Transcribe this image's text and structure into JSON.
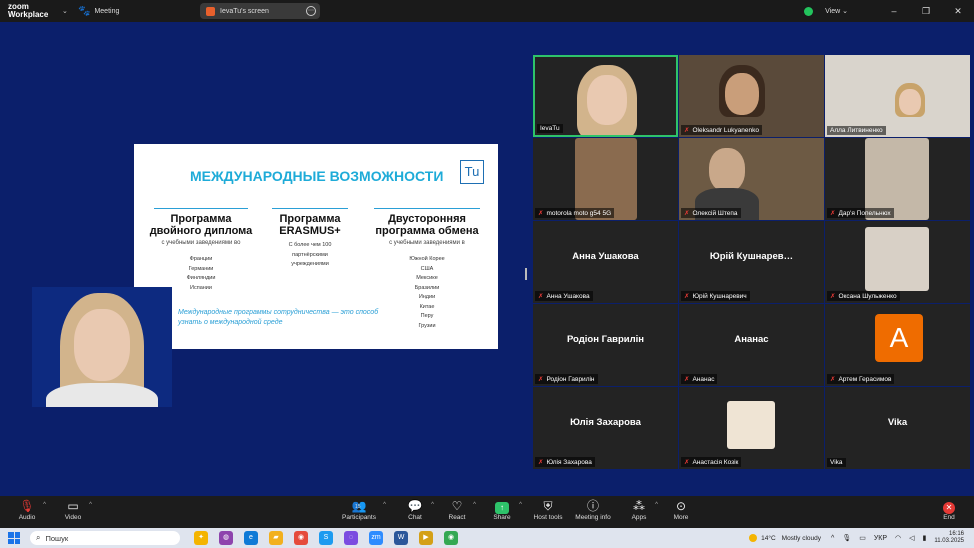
{
  "titlebar": {
    "logo_line1": "zoom",
    "logo_line2": "Workplace",
    "meeting_label": "Meeting",
    "screen_share_label": "IevaTu's screen",
    "view_label": "View",
    "window_controls": [
      "–",
      "❐",
      "✕"
    ]
  },
  "slide": {
    "title": "МЕЖДУНАРОДНЫЕ ВОЗМОЖНОСТИ",
    "logo_text": "Tu",
    "columns": [
      {
        "heading": "Программа двойного диплома",
        "sub": "с учебными заведениями во",
        "items": [
          "Франции",
          "Германии",
          "Финляндии",
          "Испании"
        ]
      },
      {
        "heading": "Программа ERASMUS+",
        "sub": "",
        "items": [
          "С более чем 100",
          "партнёрскими",
          "учреждениями"
        ]
      },
      {
        "heading": "Двусторонняя программа обмена",
        "sub": "с учебными заведениями в",
        "items": [
          "Южной Корее",
          "США",
          "Мексике",
          "Бразилии",
          "Индии",
          "Китае",
          "Перу",
          "Грузии"
        ]
      }
    ],
    "quote": "Международные программы сотрудничества — это способ узнать о международной среде"
  },
  "participants": [
    {
      "name": "IevaTu",
      "video": true,
      "muted": false,
      "active": true
    },
    {
      "name": "Oleksandr Lukyanenko",
      "video": true,
      "muted": true
    },
    {
      "name": "Алла Литвиненко",
      "video": true,
      "muted": false
    },
    {
      "name": "motorola moto g54 5G",
      "video": true,
      "muted": true
    },
    {
      "name": "Олексій Штепа",
      "video": true,
      "muted": true
    },
    {
      "name": "Дар'я Попельнюх",
      "video": true,
      "muted": true
    },
    {
      "name": "Анна Ушакова",
      "display": "Анна Ушакова",
      "video": false,
      "muted": true
    },
    {
      "name": "Юрій Кушнаревич",
      "display": "Юрій Кушнарев…",
      "video": false,
      "muted": true
    },
    {
      "name": "Оксана Шульженко",
      "video": false,
      "muted": true,
      "thumb": true
    },
    {
      "name": "Родіон Гаврилін",
      "display": "Родіон Гаврилін",
      "video": false,
      "muted": true
    },
    {
      "name": "Ананас",
      "display": "Ананас",
      "video": false,
      "muted": true
    },
    {
      "name": "Артем Герасимов",
      "video": false,
      "muted": true,
      "avatar": "A"
    },
    {
      "name": "Юлія Захарова",
      "display": "Юлія Захарова",
      "video": false,
      "muted": true
    },
    {
      "name": "Анастасія Козік",
      "video": false,
      "muted": true,
      "thumb": true
    },
    {
      "name": "Vika",
      "display": "Vika",
      "video": false,
      "muted": false
    }
  ],
  "controls": {
    "audio": "Audio",
    "video": "Video",
    "participants": "Participants",
    "participants_count": "15",
    "chat": "Chat",
    "react": "React",
    "share": "Share",
    "host_tools": "Host tools",
    "meeting_info": "Meeting info",
    "apps": "Apps",
    "more": "More",
    "end": "End"
  },
  "taskbar": {
    "search_placeholder": "Пошук",
    "weather_temp": "14°C",
    "weather_desc": "Mostly cloudy",
    "lang": "УКР",
    "time": "16:16",
    "date": "11.03.2025"
  },
  "colors": {
    "background": "#0b1f6b",
    "accent_green": "#2ec36a",
    "slide_accent": "#1eabd8",
    "mute_red": "#e53935",
    "avatar_orange": "#ef6c00"
  }
}
